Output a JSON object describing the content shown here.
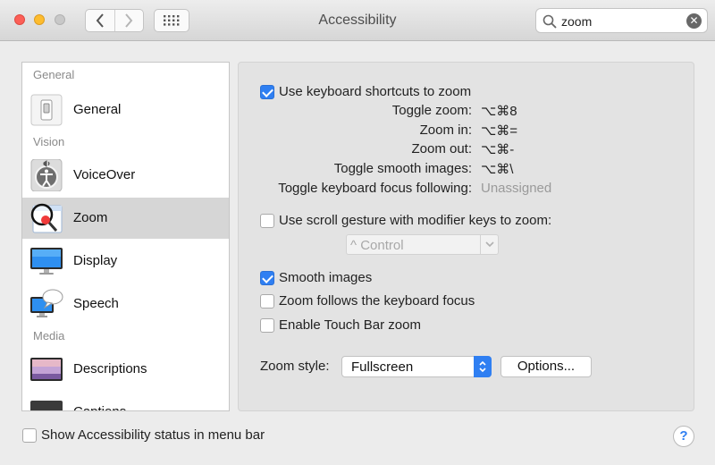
{
  "window": {
    "title": "Accessibility"
  },
  "search": {
    "value": "zoom",
    "clear_glyph": "✕"
  },
  "toolbar": {
    "back_glyph": "‹",
    "forward_glyph": "›"
  },
  "sidebar": {
    "sections": [
      {
        "label": "General"
      },
      {
        "label": "Vision"
      },
      {
        "label": "Media"
      }
    ],
    "items": [
      {
        "label": "General",
        "icon": "switch-icon"
      },
      {
        "label": "VoiceOver",
        "icon": "voiceover-icon"
      },
      {
        "label": "Zoom",
        "icon": "zoom-magnifier-icon",
        "selected": true
      },
      {
        "label": "Display",
        "icon": "display-monitor-icon"
      },
      {
        "label": "Speech",
        "icon": "speech-bubble-icon"
      },
      {
        "label": "Descriptions",
        "icon": "descriptions-icon"
      },
      {
        "label": "Captions",
        "icon": "captions-icon"
      }
    ]
  },
  "zoom": {
    "keyboard_shortcuts": {
      "label": "Use keyboard shortcuts to zoom",
      "checked": true
    },
    "shortcuts": [
      {
        "label": "Toggle zoom:",
        "value": "⌥⌘8"
      },
      {
        "label": "Zoom in:",
        "value": "⌥⌘="
      },
      {
        "label": "Zoom out:",
        "value": "⌥⌘-"
      },
      {
        "label": "Toggle smooth images:",
        "value": "⌥⌘\\"
      },
      {
        "label": "Toggle keyboard focus following:",
        "value": "Unassigned"
      }
    ],
    "scroll_gesture": {
      "label": "Use scroll gesture with modifier keys to zoom:",
      "checked": false,
      "modifier": "^ Control"
    },
    "smooth_images": {
      "label": "Smooth images",
      "checked": true
    },
    "follow_focus": {
      "label": "Zoom follows the keyboard focus",
      "checked": false
    },
    "touch_bar": {
      "label": "Enable Touch Bar zoom",
      "checked": false
    },
    "zoom_style": {
      "label": "Zoom style:",
      "value": "Fullscreen"
    },
    "options_button": "Options..."
  },
  "footer": {
    "status_menu": {
      "label": "Show Accessibility status in menu bar",
      "checked": false
    },
    "help_label": "?"
  },
  "colors": {
    "accent": "#2f7ff2",
    "selection": "#d6d6d6",
    "close": "#fc5f57",
    "minimize": "#fdbc2e"
  }
}
